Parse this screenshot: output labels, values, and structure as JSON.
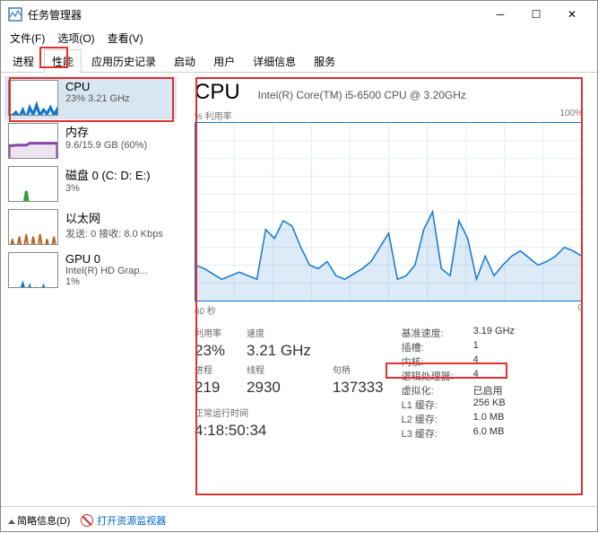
{
  "window": {
    "title": "任务管理器"
  },
  "menu": {
    "file": "文件(F)",
    "options": "选项(O)",
    "view": "查看(V)"
  },
  "tabs": [
    "进程",
    "性能",
    "应用历史记录",
    "启动",
    "用户",
    "详细信息",
    "服务"
  ],
  "sidebar": [
    {
      "title": "CPU",
      "sub": "23% 3.21 GHz",
      "color": "#1177cc"
    },
    {
      "title": "内存",
      "sub": "9.6/15.9 GB (60%)",
      "color": "#8846a3"
    },
    {
      "title": "磁盘 0 (C: D: E:)",
      "sub": "3%",
      "color": "#3a9a3a"
    },
    {
      "title": "以太网",
      "sub": "发送: 0 接收: 8.0 Kbps",
      "color": "#b5651d"
    },
    {
      "title": "GPU 0",
      "sub": "Intel(R) HD Grap...",
      "sub2": "1%",
      "color": "#1177cc"
    }
  ],
  "main": {
    "title": "CPU",
    "model": "Intel(R) Core(TM) i5-6500 CPU @ 3.20GHz",
    "chart_tl": "% 利用率",
    "chart_tr": "100%",
    "chart_bl": "60 秒",
    "chart_br": "0",
    "stats_left": {
      "util_l": "利用率",
      "util_v": "23%",
      "speed_l": "速度",
      "speed_v": "3.21 GHz",
      "proc_l": "进程",
      "proc_v": "219",
      "thr_l": "线程",
      "thr_v": "2930",
      "hnd_l": "句柄",
      "hnd_v": "137333",
      "uptime_l": "正常运行时间",
      "uptime_v": "4:18:50:34"
    },
    "stats_right": [
      {
        "k": "基准速度:",
        "v": "3.19 GHz"
      },
      {
        "k": "插槽:",
        "v": "1"
      },
      {
        "k": "内核:",
        "v": "4"
      },
      {
        "k": "逻辑处理器:",
        "v": "4"
      },
      {
        "k": "虚拟化:",
        "v": "已启用"
      },
      {
        "k": "L1 缓存:",
        "v": "256 KB"
      },
      {
        "k": "L2 缓存:",
        "v": "1.0 MB"
      },
      {
        "k": "L3 缓存:",
        "v": "6.0 MB"
      }
    ]
  },
  "status": {
    "brief": "简略信息(D)",
    "open_resmon": "打开资源监视器"
  },
  "chart_data": {
    "type": "line",
    "title": "% 利用率",
    "ylim": [
      0,
      100
    ],
    "xlabel": "60 秒 → 0",
    "values": [
      20,
      18,
      15,
      12,
      14,
      16,
      14,
      12,
      40,
      35,
      45,
      42,
      30,
      20,
      18,
      22,
      14,
      12,
      15,
      18,
      22,
      30,
      38,
      12,
      14,
      20,
      40,
      50,
      18,
      14,
      45,
      35,
      12,
      25,
      14,
      20,
      25,
      28,
      24,
      20,
      22,
      25,
      30,
      28,
      25
    ]
  },
  "sidebar_thumbs": {
    "cpu": [
      70,
      72,
      65,
      75,
      60,
      78,
      55,
      70,
      50,
      72,
      60,
      68,
      55,
      70,
      58
    ],
    "mem": [
      45,
      45,
      44,
      44,
      44,
      44,
      40,
      40,
      40,
      40,
      40,
      40,
      40,
      40,
      40
    ],
    "disk": [
      95,
      90,
      98,
      85,
      96,
      50,
      95,
      92,
      98,
      94,
      90,
      96,
      93,
      95,
      92
    ],
    "eth_up": [
      98,
      98,
      98,
      98,
      98,
      98,
      98,
      98,
      98,
      98,
      98,
      98,
      98,
      98,
      98
    ],
    "eth_dn": [
      95,
      60,
      98,
      55,
      97,
      50,
      98,
      55,
      96,
      50,
      98,
      60,
      95,
      55,
      96
    ],
    "gpu": [
      95,
      80,
      98,
      85,
      65,
      90,
      70,
      95,
      75,
      88,
      70,
      92,
      78,
      90,
      72
    ]
  }
}
